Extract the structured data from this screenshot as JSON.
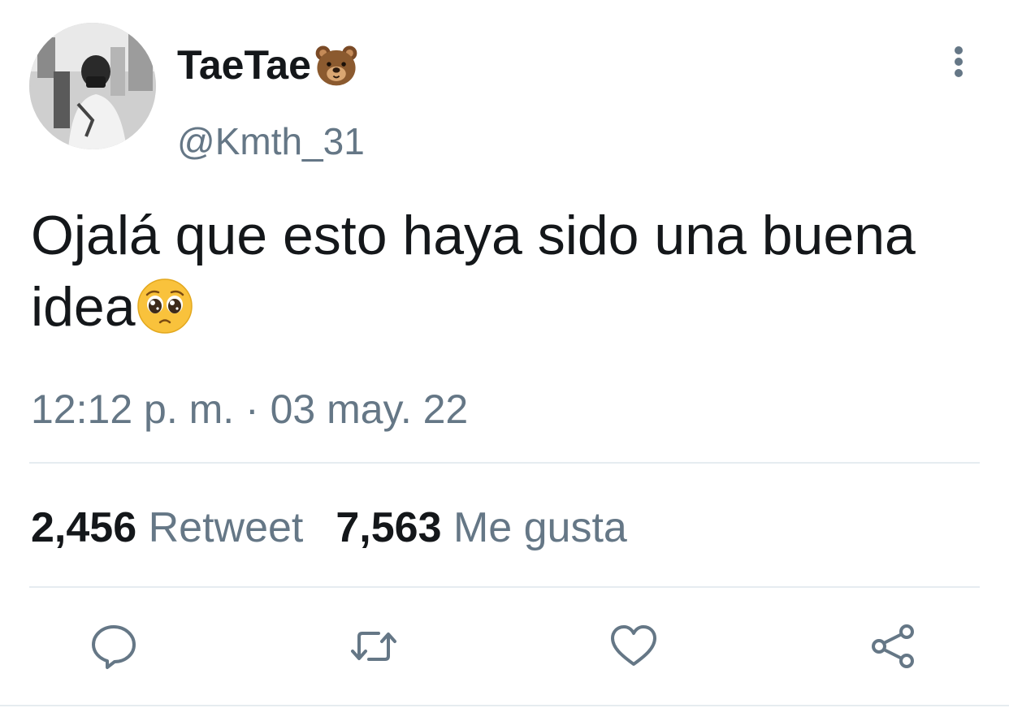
{
  "user": {
    "display_name": "TaeTae",
    "name_emoji": "bear-face-emoji",
    "handle": "@Kmth_31"
  },
  "tweet": {
    "text": "Ojalá que esto haya sido una buena idea",
    "trailing_emoji": "pleading-face-emoji",
    "timestamp": "12:12 p. m. · 03 may. 22"
  },
  "stats": {
    "retweets_count": "2,456",
    "retweets_label": "Retweet",
    "likes_count": "7,563",
    "likes_label": "Me gusta"
  },
  "actions": [
    "reply-icon",
    "retweet-icon",
    "like-icon",
    "share-icon"
  ],
  "colors": {
    "text_primary": "#14171a",
    "text_secondary": "#657786",
    "divider": "#e6ecf0",
    "icon": "#657786"
  }
}
